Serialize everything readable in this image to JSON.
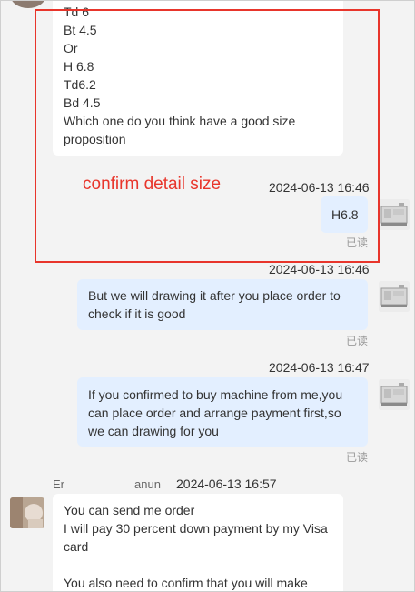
{
  "messages": {
    "first_incoming": {
      "lines": [
        "Td 6",
        "Bt 4.5",
        "Or",
        "H 6.8",
        "Td6.2",
        "Bd 4.5",
        "Which one do you think have a good size",
        "proposition"
      ]
    },
    "annotation": "confirm detail size",
    "reply1": {
      "timestamp": "2024-06-13 16:46",
      "text": "H6.8",
      "status": "已读"
    },
    "reply2": {
      "timestamp": "2024-06-13 16:46",
      "lines": [
        "But we will drawing it after you place order to",
        "check if it is good"
      ],
      "status": "已读"
    },
    "reply3": {
      "timestamp": "2024-06-13 16:47",
      "lines": [
        "If you confirmed to buy machine from me,you",
        "can place order and arrange payment first,so",
        "we can drawing for you"
      ],
      "status": "已读"
    },
    "incoming2": {
      "sender_prefix": "Er",
      "sender_suffix": "anun",
      "timestamp": "2024-06-13 16:57",
      "lines": [
        "You can send me order",
        "I will pay 30 percent down payment by my Visa",
        "card",
        "",
        "You also need to confirm that you will make"
      ]
    }
  },
  "colors": {
    "annotation_red": "#e8352b",
    "outgoing_bubble": "#e3efff",
    "incoming_bubble": "#ffffff",
    "read_status": "#9a9a9a"
  }
}
